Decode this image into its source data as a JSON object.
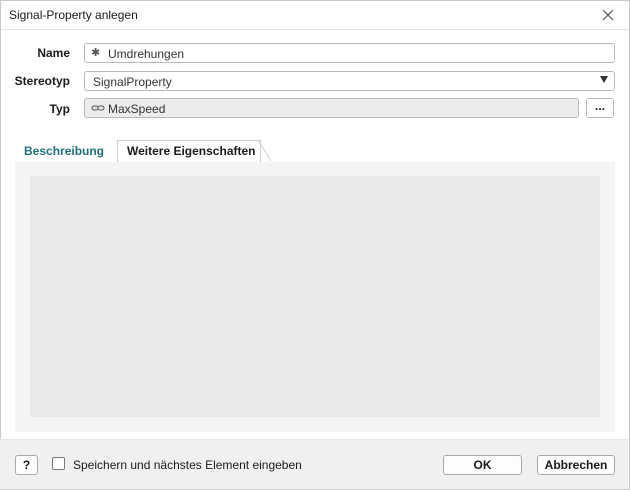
{
  "window": {
    "title": "Signal-Property anlegen"
  },
  "form": {
    "name_label": "Name",
    "name_value": "Umdrehungen",
    "name_icon": "asterisk-icon",
    "stereotyp_label": "Stereotyp",
    "stereotyp_value": "SignalProperty",
    "typ_label": "Typ",
    "typ_value": "MaxSpeed",
    "typ_icon": "link-icon",
    "browse_label": "..."
  },
  "tabs": [
    {
      "label": "Beschreibung"
    },
    {
      "label": "Weitere Eigenschaften"
    }
  ],
  "footer": {
    "help_label": "?",
    "checkbox_label": "Speichern und nächstes Element eingeben",
    "ok_label": "OK",
    "cancel_label": "Abbrechen"
  },
  "colors": {
    "tab_accent": "#1e6f7d"
  }
}
